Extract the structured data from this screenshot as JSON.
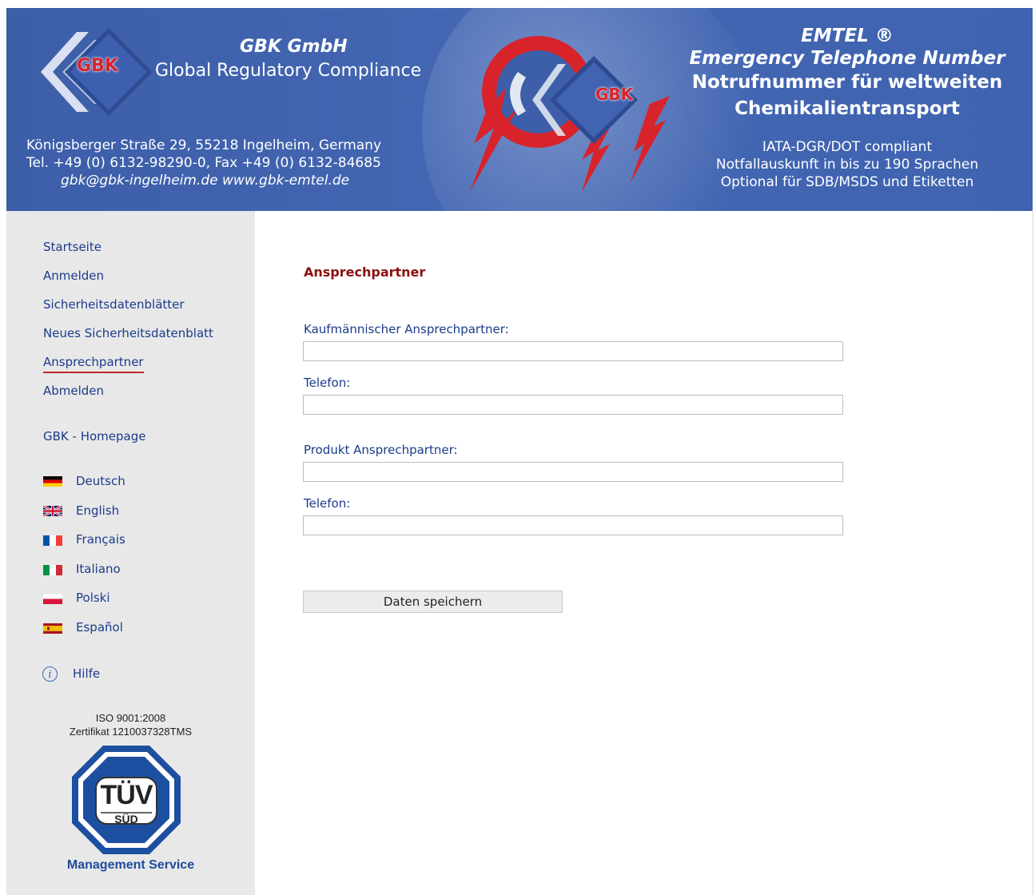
{
  "header": {
    "logo_text": "GBK",
    "company_name": "GBK GmbH",
    "company_subtitle": "Global Regulatory Compliance",
    "address_line": "Königsberger Straße 29, 55218 Ingelheim, Germany",
    "phone_line": "Tel. +49 (0) 6132-98290-0, Fax +49 (0) 6132-84685",
    "web_line": "gbk@gbk-ingelheim.de   www.gbk-emtel.de",
    "emtel_title": "EMTEL ®",
    "emtel_subtitle": "Emergency Telephone Number",
    "notruf_line1": "Notrufnummer für weltweiten",
    "notruf_line2": "Chemikalientransport",
    "info_line1": "IATA-DGR/DOT compliant",
    "info_line2": "Notfallauskunft in bis zu 190 Sprachen",
    "info_line3": "Optional für SDB/MSDS und Etiketten"
  },
  "sidebar": {
    "nav": [
      {
        "label": "Startseite"
      },
      {
        "label": "Anmelden"
      },
      {
        "label": "Sicherheitsdatenblätter"
      },
      {
        "label": "Neues Sicherheitsdatenblatt"
      },
      {
        "label": "Ansprechpartner",
        "active": true
      },
      {
        "label": "Abmelden"
      }
    ],
    "homepage_label": "GBK - Homepage",
    "languages": [
      {
        "label": "Deutsch",
        "flag": "flag-de"
      },
      {
        "label": "English",
        "flag": "flag-uk"
      },
      {
        "label": "Français",
        "flag": "flag-fr"
      },
      {
        "label": "Italiano",
        "flag": "flag-it"
      },
      {
        "label": "Polski",
        "flag": "flag-pl"
      },
      {
        "label": "Español",
        "flag": "flag-es"
      }
    ],
    "help_label": "Hilfe",
    "iso_line1": "ISO 9001:2008",
    "iso_line2": "Zertifikat 1210037328TMS",
    "tuev_text": "TÜV",
    "tuev_sub": "SÜD",
    "tuev_caption": "Management Service"
  },
  "main": {
    "title": "Ansprechpartner",
    "fields": [
      {
        "label": "Kaufmännischer Ansprechpartner:",
        "value": ""
      },
      {
        "label": "Telefon:",
        "value": ""
      },
      {
        "label": "Produkt Ansprechpartner:",
        "value": ""
      },
      {
        "label": "Telefon:",
        "value": ""
      }
    ],
    "save_label": "Daten speichern"
  },
  "colors": {
    "header_blue": "#4467b3",
    "sidebar_bg": "#e8e8e8",
    "link_blue": "#1a3b8b",
    "title_red": "#8b0f0f",
    "active_underline": "#c0272d"
  }
}
